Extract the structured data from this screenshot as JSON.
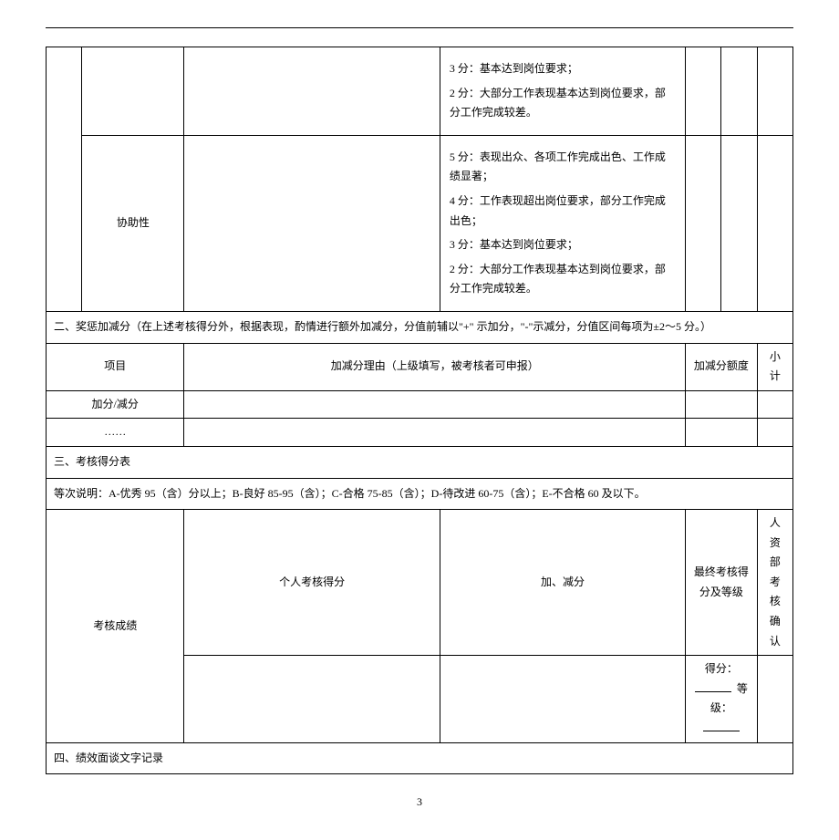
{
  "criteria_row1": {
    "line3": "3 分：基本达到岗位要求；",
    "line4": "2 分：大部分工作表现基本达到岗位要求，部分工作完成较差。"
  },
  "criteria_row2": {
    "label": "协助性",
    "line1": "5 分：表现出众、各项工作完成出色、工作成绩显著；",
    "line2": "4 分：工作表现超出岗位要求，部分工作完成出色；",
    "line3": "3 分：基本达到岗位要求；",
    "line4": "2 分：大部分工作表现基本达到岗位要求，部分工作完成较差。"
  },
  "section2": {
    "title": "二、奖惩加减分（在上述考核得分外，根据表现，酌情进行额外加减分，分值前辅以\"+\" 示加分，\"-\"示减分，分值区间每项为±2～5 分。）",
    "col1": "项目",
    "col2": "加减分理由（上级填写，被考核者可申报）",
    "col3": "加减分额度",
    "col4": "小计",
    "row1": "加分/减分",
    "row2": "……"
  },
  "section3": {
    "title": "三、考核得分表",
    "note": "等次说明：A-优秀 95（含）分以上；B-良好 85-95（含）；C-合格 75-85（含）；D-待改进 60-75（含）；E-不合格  60 及以下。",
    "col1": "考核成绩",
    "col2": "个人考核得分",
    "col3": "加、减分",
    "col4": "最终考核得分及等级",
    "col5": "人资部考核确认",
    "score_label": "得分：",
    "grade_label": "等级："
  },
  "section4": {
    "title": "四、绩效面谈文字记录"
  },
  "page_number": "3"
}
